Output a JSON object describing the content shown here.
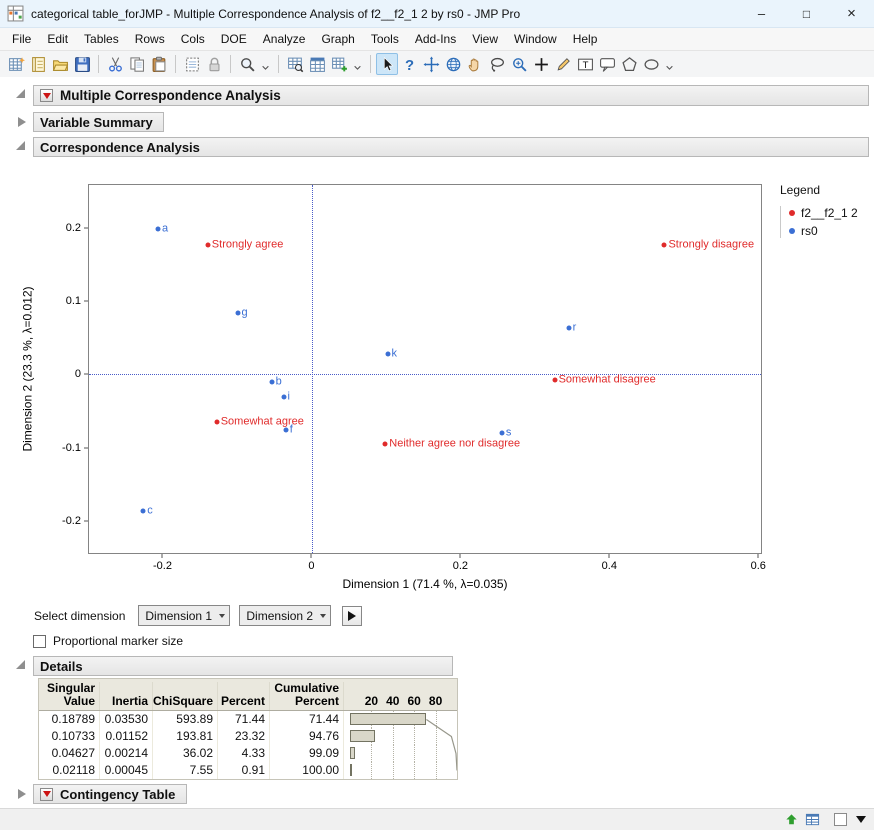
{
  "window": {
    "title": "categorical table_forJMP - Multiple Correspondence Analysis of f2__f2_1 2 by rs0 - JMP Pro",
    "controls": {
      "minimize": "–",
      "maximize": "□",
      "close": "×"
    }
  },
  "menu": {
    "items": [
      "File",
      "Edit",
      "Tables",
      "Rows",
      "Cols",
      "DOE",
      "Analyze",
      "Graph",
      "Tools",
      "Add-Ins",
      "View",
      "Window",
      "Help"
    ]
  },
  "toolbar": {
    "selected_tool": "arrow",
    "groups": [
      {
        "icons": [
          "new-data-table",
          "new-journal",
          "open",
          "save"
        ],
        "overflow": false
      },
      {
        "icons": [
          "cut",
          "copy",
          "paste"
        ],
        "overflow": false
      },
      {
        "icons": [
          "copy-selection",
          "lock"
        ],
        "overflow": false
      },
      {
        "icons": [
          "magnifier"
        ],
        "overflow": true
      },
      {
        "icons": [
          "table-search",
          "table-window",
          "table-add"
        ],
        "overflow": true
      },
      {
        "icons": [
          "arrow",
          "help",
          "crosshair",
          "globe",
          "hand",
          "lasso",
          "zoom",
          "plus",
          "pencil",
          "text-box",
          "callout",
          "polygon",
          "oval"
        ],
        "overflow": true
      }
    ]
  },
  "outline": {
    "mca": "Multiple Correspondence Analysis",
    "variable_summary": "Variable Summary",
    "correspondence": "Correspondence Analysis",
    "details": "Details",
    "contingency": "Contingency Table"
  },
  "chart_data": {
    "type": "scatter",
    "xlabel": "Dimension 1 (71.4 %, λ=0.035)",
    "ylabel": "Dimension 2  (23.3 %, λ=0.012)",
    "xlim": [
      -0.3,
      0.605
    ],
    "ylim": [
      -0.245,
      0.26
    ],
    "xticks": [
      "-0.2",
      "0",
      "0.2",
      "0.4",
      "0.6"
    ],
    "yticks": [
      "0.2",
      "0.1",
      "0",
      "-0.1",
      "-0.2"
    ],
    "reference_lines": {
      "x": 0,
      "y": 0
    },
    "grid": false,
    "legend_position": "right",
    "series": [
      {
        "name": "f2__f2_1 2",
        "color": "#e02b2b",
        "marker": "circle",
        "points": [
          {
            "label": "Strongly agree",
            "x": -0.14,
            "y": 0.178
          },
          {
            "label": "Strongly disagree",
            "x": 0.475,
            "y": 0.177
          },
          {
            "label": "Somewhat disagree",
            "x": 0.327,
            "y": -0.008
          },
          {
            "label": "Somewhat agree",
            "x": -0.128,
            "y": -0.065
          },
          {
            "label": "Neither agree nor disagree",
            "x": 0.099,
            "y": -0.095
          }
        ]
      },
      {
        "name": "rs0",
        "color": "#3b6fd4",
        "marker": "circle",
        "points": [
          {
            "label": "a",
            "x": -0.207,
            "y": 0.2
          },
          {
            "label": "g",
            "x": -0.1,
            "y": 0.085
          },
          {
            "label": "r",
            "x": 0.346,
            "y": 0.064
          },
          {
            "label": "k",
            "x": 0.102,
            "y": 0.028
          },
          {
            "label": "b",
            "x": -0.054,
            "y": -0.01
          },
          {
            "label": "i",
            "x": -0.038,
            "y": -0.031
          },
          {
            "label": "f",
            "x": -0.035,
            "y": -0.076
          },
          {
            "label": "s",
            "x": 0.256,
            "y": -0.08
          },
          {
            "label": "c",
            "x": -0.227,
            "y": -0.188
          }
        ]
      }
    ]
  },
  "legend": {
    "title": "Legend",
    "items": [
      {
        "label": "f2__f2_1 2",
        "color": "#e02b2b"
      },
      {
        "label": "rs0",
        "color": "#3b6fd4"
      }
    ]
  },
  "controls": {
    "select_dimension_label": "Select dimension",
    "dimension_x": "Dimension 1",
    "dimension_y": "Dimension 2",
    "proportional_marker_label": "Proportional marker size",
    "proportional_checked": false
  },
  "details_table": {
    "columns": [
      {
        "top": "Singular",
        "bottom": "Value"
      },
      {
        "top": "",
        "bottom": "Inertia"
      },
      {
        "top": "",
        "bottom": "ChiSquare"
      },
      {
        "top": "",
        "bottom": "Percent"
      },
      {
        "top": "Cumulative",
        "bottom": "Percent"
      }
    ],
    "axis_ticks": [
      "20",
      "40",
      "60",
      "80"
    ],
    "rows": [
      {
        "singular_value": "0.18789",
        "inertia": "0.03530",
        "chi_square": "593.89",
        "percent": "71.44",
        "cumulative_percent": "71.44"
      },
      {
        "singular_value": "0.10733",
        "inertia": "0.01152",
        "chi_square": "193.81",
        "percent": "23.32",
        "cumulative_percent": "94.76"
      },
      {
        "singular_value": "0.04627",
        "inertia": "0.00214",
        "chi_square": "36.02",
        "percent": "4.33",
        "cumulative_percent": "99.09"
      },
      {
        "singular_value": "0.02118",
        "inertia": "0.00045",
        "chi_square": "7.55",
        "percent": "0.91",
        "cumulative_percent": "100.00"
      }
    ]
  },
  "statusbar": {
    "icons": [
      "status-home",
      "status-table"
    ]
  }
}
